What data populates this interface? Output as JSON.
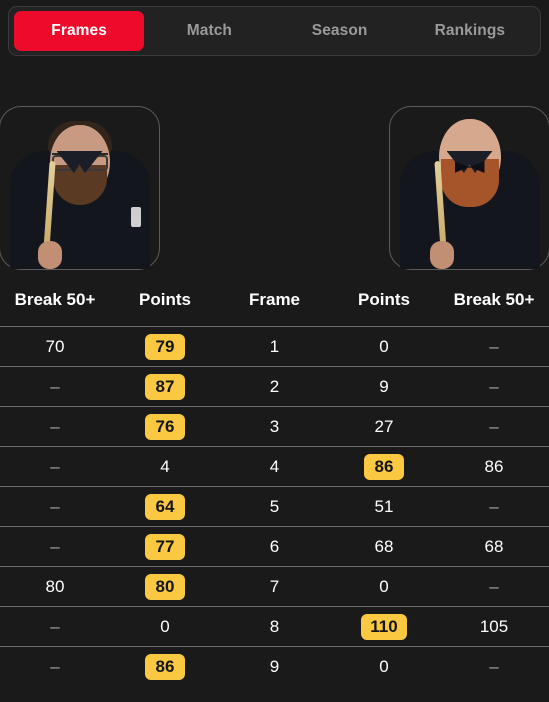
{
  "tabs": [
    {
      "label": "Frames",
      "active": true
    },
    {
      "label": "Match",
      "active": false
    },
    {
      "label": "Season",
      "active": false
    },
    {
      "label": "Rankings",
      "active": false
    }
  ],
  "players": {
    "left": {
      "description": "snooker player with dark hair, beard and glasses wearing a black shirt holding a cue"
    },
    "right": {
      "description": "bald snooker player with ginger beard wearing a black shirt and bow tie holding a cue"
    }
  },
  "table": {
    "headers": [
      "Break 50+",
      "Points",
      "Frame",
      "Points",
      "Break 50+"
    ],
    "rows": [
      {
        "left_break": "70",
        "left_points": "79",
        "left_won": true,
        "frame": "1",
        "right_points": "0",
        "right_won": false,
        "right_break": "–"
      },
      {
        "left_break": "–",
        "left_points": "87",
        "left_won": true,
        "frame": "2",
        "right_points": "9",
        "right_won": false,
        "right_break": "–"
      },
      {
        "left_break": "–",
        "left_points": "76",
        "left_won": true,
        "frame": "3",
        "right_points": "27",
        "right_won": false,
        "right_break": "–"
      },
      {
        "left_break": "–",
        "left_points": "4",
        "left_won": false,
        "frame": "4",
        "right_points": "86",
        "right_won": true,
        "right_break": "86"
      },
      {
        "left_break": "–",
        "left_points": "64",
        "left_won": true,
        "frame": "5",
        "right_points": "51",
        "right_won": false,
        "right_break": "–"
      },
      {
        "left_break": "–",
        "left_points": "77",
        "left_won": true,
        "frame": "6",
        "right_points": "68",
        "right_won": false,
        "right_break": "68"
      },
      {
        "left_break": "80",
        "left_points": "80",
        "left_won": true,
        "frame": "7",
        "right_points": "0",
        "right_won": false,
        "right_break": "–"
      },
      {
        "left_break": "–",
        "left_points": "0",
        "left_won": false,
        "frame": "8",
        "right_points": "110",
        "right_won": true,
        "right_break": "105"
      },
      {
        "left_break": "–",
        "left_points": "86",
        "left_won": true,
        "frame": "9",
        "right_points": "0",
        "right_won": false,
        "right_break": "–"
      }
    ]
  },
  "colors": {
    "page_background": "#1a1a1a",
    "tab_container": "#222222",
    "active_tab": "#ed0a2b",
    "inactive_tab_text": "#9a9a9a",
    "winner_badge": "#fbc941",
    "row_divider": "#6e6e6e"
  }
}
